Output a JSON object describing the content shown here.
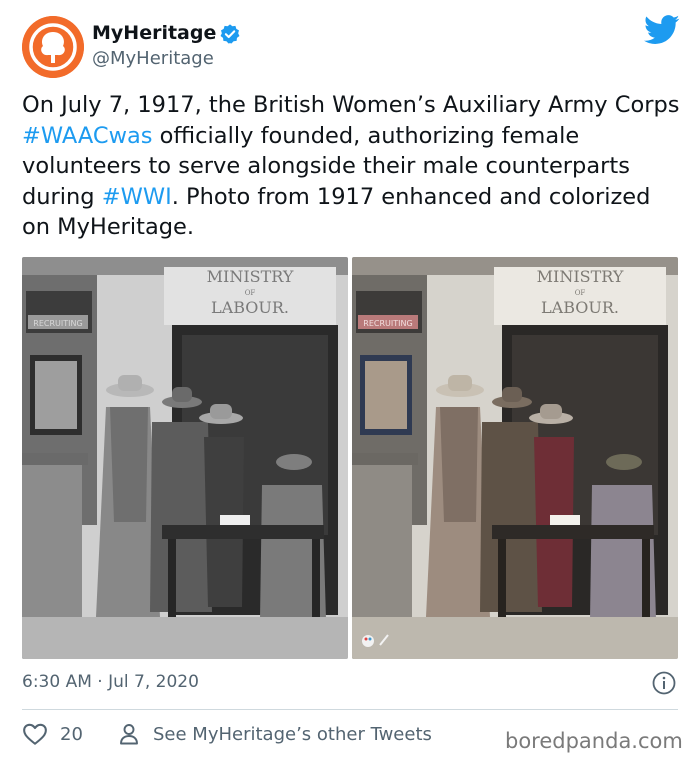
{
  "author": {
    "display_name": "MyHeritage",
    "handle": "@MyHeritage",
    "verified": true,
    "avatar_color": "#f26b2a"
  },
  "tweet": {
    "text_1": "On July 7, 1917, the British Women’s Auxiliary Army Corps ",
    "hashtag_1": "#WAACwas",
    "text_2": " officially founded, authorizing female volunteers to serve alongside their male counterparts during ",
    "hashtag_2": "#WWI",
    "text_3": ". Photo from 1917 enhanced and colorized on MyHeritage.",
    "hashtag_color": "#1d9bf0"
  },
  "photos": {
    "left": {
      "sign_line_1": "MINISTRY",
      "sign_line_2": "OF",
      "sign_line_3": "LABOUR.",
      "poster_label": "RECRUITING",
      "style": "black-and-white"
    },
    "right": {
      "sign_line_1": "MINISTRY",
      "sign_line_2": "OF",
      "sign_line_3": "LABOUR.",
      "poster_label": "RECRUITING",
      "style": "colorized"
    }
  },
  "meta": {
    "timestamp": "6:30 AM · Jul 7, 2020"
  },
  "actions": {
    "like_count": "20",
    "see_other_tweets": "See MyHeritage’s other Tweets"
  },
  "watermark": "boredpanda.com",
  "icons": {
    "brand": "twitter-bird-icon",
    "info": "info-icon",
    "like": "heart-icon",
    "profile": "person-icon",
    "verified": "verified-badge-icon"
  }
}
